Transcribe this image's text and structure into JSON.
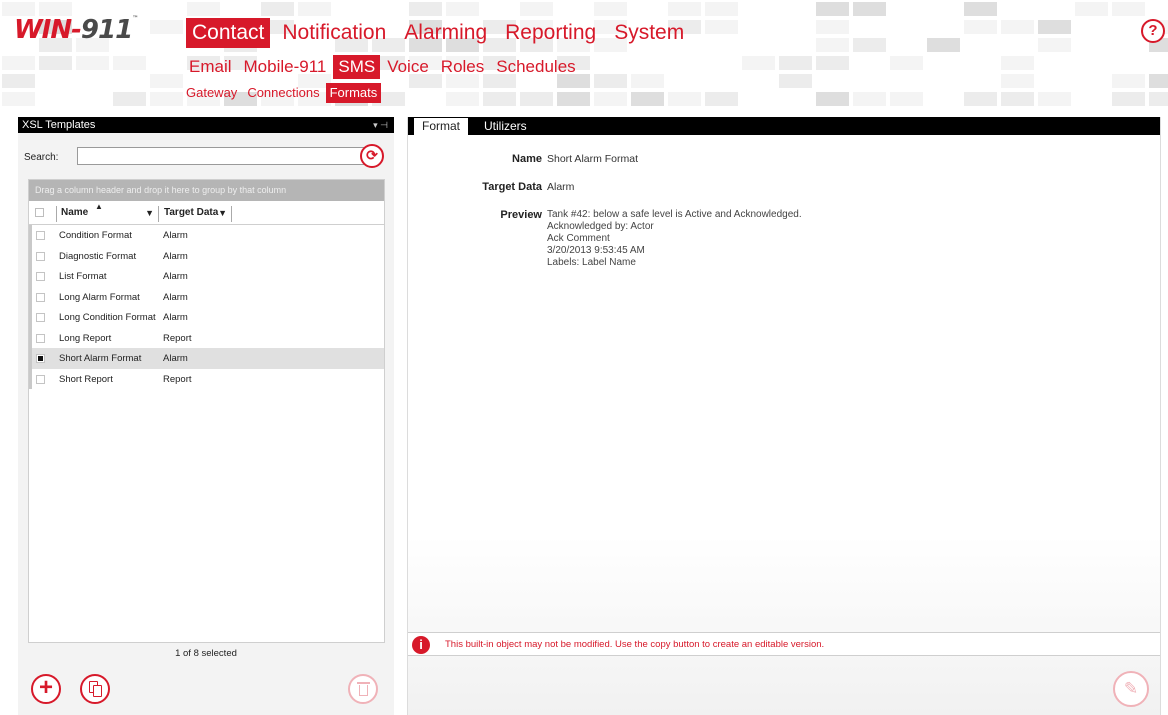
{
  "app": {
    "logo_main": "WIN-",
    "logo_num": "911",
    "logo_tm": "™",
    "help_icon": "?"
  },
  "nav_primary": [
    "Contact",
    "Notification",
    "Alarming",
    "Reporting",
    "System"
  ],
  "nav_primary_selected": "Contact",
  "nav_secondary": [
    "Email",
    "Mobile-911",
    "SMS",
    "Voice",
    "Roles",
    "Schedules"
  ],
  "nav_secondary_selected": "SMS",
  "nav_tertiary": [
    "Gateway",
    "Connections",
    "Formats"
  ],
  "nav_tertiary_selected": "Formats",
  "left_panel": {
    "title": "XSL Templates",
    "pin_icon": "▾ ⊣",
    "search_label": "Search:",
    "search_value": "",
    "group_hint": "Drag a column header and drop it here to group by that column",
    "columns": [
      "Name",
      "Target Data"
    ],
    "rows": [
      {
        "name": "Condition Format",
        "target": "Alarm",
        "selected": false
      },
      {
        "name": "Diagnostic Format",
        "target": "Alarm",
        "selected": false
      },
      {
        "name": "List Format",
        "target": "Alarm",
        "selected": false
      },
      {
        "name": "Long Alarm Format",
        "target": "Alarm",
        "selected": false
      },
      {
        "name": "Long Condition Format",
        "target": "Alarm",
        "selected": false
      },
      {
        "name": "Long Report",
        "target": "Report",
        "selected": false
      },
      {
        "name": "Short Alarm Format",
        "target": "Alarm",
        "selected": true
      },
      {
        "name": "Short Report",
        "target": "Report",
        "selected": false
      }
    ],
    "selection_count": "1 of 8 selected"
  },
  "right_panel": {
    "tabs": [
      "Format",
      "Utilizers"
    ],
    "selected_tab": "Format",
    "name_label": "Name",
    "name_value": "Short Alarm Format",
    "target_label": "Target Data",
    "target_value": "Alarm",
    "preview_label": "Preview",
    "preview_lines": [
      "Tank #42: below a safe level is Active and Acknowledged.",
      "Acknowledged by: Actor",
      "Ack Comment",
      "3/20/2013 9:53:45 AM",
      "Labels: Label Name"
    ],
    "warning": "This built-in object may not be modified. Use the copy button to create an editable version."
  },
  "colors": {
    "accent": "#d7192a",
    "accent_disabled": "#f0b2b8",
    "panel_header": "#000000"
  }
}
